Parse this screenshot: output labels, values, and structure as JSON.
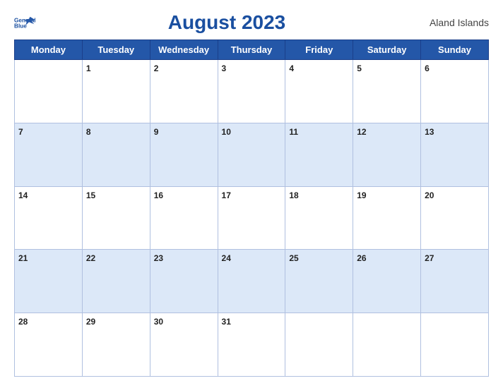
{
  "header": {
    "logo_line1": "General",
    "logo_line2": "Blue",
    "title": "August 2023",
    "region": "Aland Islands"
  },
  "weekdays": [
    "Monday",
    "Tuesday",
    "Wednesday",
    "Thursday",
    "Friday",
    "Saturday",
    "Sunday"
  ],
  "weeks": [
    [
      null,
      1,
      2,
      3,
      4,
      5,
      6
    ],
    [
      7,
      8,
      9,
      10,
      11,
      12,
      13
    ],
    [
      14,
      15,
      16,
      17,
      18,
      19,
      20
    ],
    [
      21,
      22,
      23,
      24,
      25,
      26,
      27
    ],
    [
      28,
      29,
      30,
      31,
      null,
      null,
      null
    ]
  ]
}
